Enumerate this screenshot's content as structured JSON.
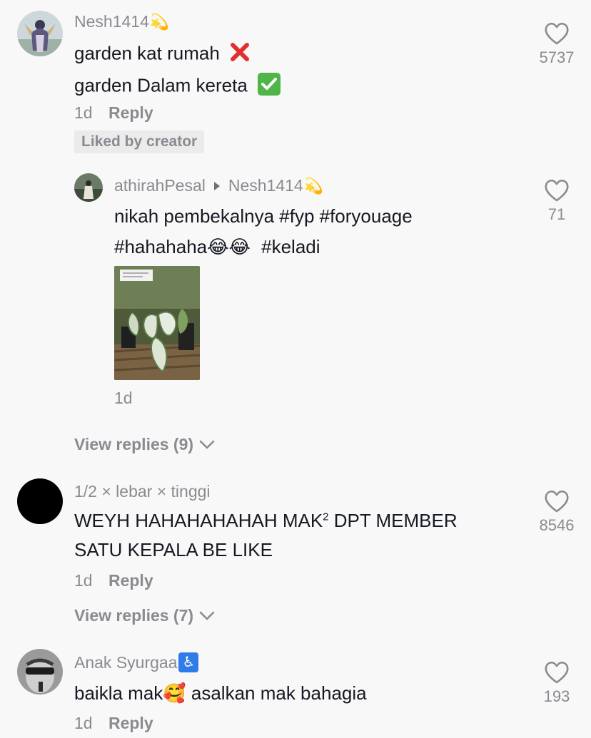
{
  "comments": [
    {
      "username": "Nesh1414",
      "username_emoji": "💫",
      "lines": [
        "garden kat rumah",
        "garden Dalam kereta"
      ],
      "line_marks": [
        "❌",
        "✅"
      ],
      "time": "1d",
      "reply_label": "Reply",
      "liked_by_creator": "Liked by creator",
      "likes": "5737",
      "reply": {
        "username": "athirahPesal",
        "reply_to": "Nesh1414",
        "reply_to_emoji": "💫",
        "line1": "nikah pembekalnya #fyp #foryouage",
        "line2_a": "#hahahaha",
        "line2_emoji": "😂😂",
        "line2_b": "#keladi",
        "time": "1d",
        "likes": "71"
      },
      "view_replies": "View replies (9)"
    },
    {
      "username": "1/2 × lebar × tinggi",
      "line1_a": "WEYH HAHAHAHAHAH MAK",
      "line1_sup": "2",
      "line1_b": " DPT MEMBER",
      "line2": "SATU KEPALA BE LIKE",
      "time": "1d",
      "reply_label": "Reply",
      "likes": "8546",
      "view_replies": "View replies (7)"
    },
    {
      "username": "Anak Syurgaa",
      "username_emoji": "♿",
      "line_a": "baikla mak",
      "line_emoji": "🥰",
      "line_b": " asalkan mak bahagia",
      "time": "1d",
      "reply_label": "Reply",
      "likes": "193"
    }
  ],
  "colors": {
    "background": "#f8f8f8",
    "text_primary": "#161823",
    "text_secondary": "#8a8b91",
    "badge_bg": "#ebebeb",
    "red_mark": "#e0302e",
    "green_mark": "#4fb548",
    "accessibility_blue": "#2f7be8"
  },
  "icons": {
    "like": "heart-outline-icon",
    "expand": "chevron-down-icon",
    "reply_arrow": "triangle-right-icon"
  }
}
